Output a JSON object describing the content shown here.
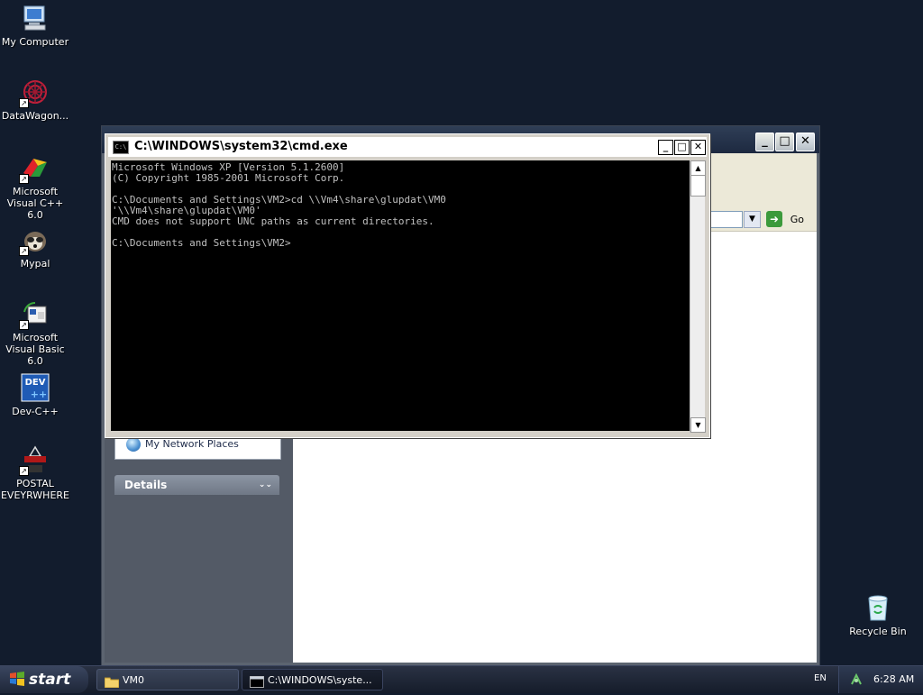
{
  "desktop": {
    "icons": [
      {
        "label": "My Computer",
        "icon": "computer-icon"
      },
      {
        "label": "DataWagon...",
        "icon": "datawagon-icon"
      },
      {
        "label": "Microsoft Visual C++ 6.0",
        "icon": "visual-cpp-icon"
      },
      {
        "label": "Mypal",
        "icon": "mypal-icon"
      },
      {
        "label": "Microsoft Visual Basic 6.0",
        "icon": "visual-basic-icon"
      },
      {
        "label": "Dev-C++",
        "icon": "dev-cpp-icon"
      },
      {
        "label": "POSTAL EVEYRWHERE",
        "icon": "postal-icon"
      },
      {
        "label": "Recycle Bin",
        "icon": "recycle-bin-icon"
      }
    ]
  },
  "explorer": {
    "go_label": "Go",
    "sidebar": {
      "network_places": "My Network Places",
      "details_header": "Details"
    }
  },
  "cmd": {
    "title": "C:\\WINDOWS\\system32\\cmd.exe",
    "icon_text": "C:\\",
    "console_lines": [
      "Microsoft Windows XP [Version 5.1.2600]",
      "(C) Copyright 1985-2001 Microsoft Corp.",
      "",
      "C:\\Documents and Settings\\VM2>cd \\\\Vm4\\share\\glupdat\\VM0",
      "'\\\\Vm4\\share\\glupdat\\VM0'",
      "CMD does not support UNC paths as current directories.",
      "",
      "C:\\Documents and Settings\\VM2>"
    ]
  },
  "taskbar": {
    "start_label": "start",
    "tasks": [
      {
        "label": "VM0",
        "icon": "folder-icon"
      },
      {
        "label": "C:\\WINDOWS\\syste...",
        "icon": "cmd-icon"
      }
    ],
    "language": "EN",
    "clock": "6:28 AM"
  }
}
